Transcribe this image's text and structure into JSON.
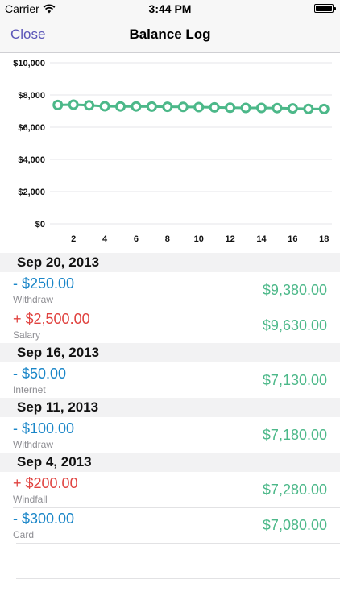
{
  "status_bar": {
    "carrier": "Carrier",
    "time": "3:44 PM"
  },
  "nav": {
    "close_label": "Close",
    "title": "Balance Log"
  },
  "colors": {
    "line": "#4cb889",
    "minus": "#1a86c8",
    "plus": "#e0423f",
    "balance": "#4cb889",
    "nav_tint": "#5a55b8"
  },
  "chart_data": {
    "type": "line",
    "y_ticks": [
      "$10,000",
      "$8,000",
      "$6,000",
      "$4,000",
      "$2,000",
      "$0"
    ],
    "x_ticks": [
      "2",
      "4",
      "6",
      "8",
      "10",
      "12",
      "14",
      "16",
      "18"
    ],
    "ylim": [
      0,
      10000
    ],
    "x": [
      1,
      2,
      3,
      4,
      5,
      6,
      7,
      8,
      9,
      10,
      11,
      12,
      13,
      14,
      15,
      16,
      17,
      18
    ],
    "series": [
      {
        "values": [
          7380,
          7400,
          7360,
          7300,
          7290,
          7290,
          7280,
          7270,
          7260,
          7250,
          7230,
          7210,
          7200,
          7200,
          7190,
          7170,
          7140,
          7130
        ]
      }
    ],
    "grid": true
  },
  "sections": [
    {
      "date": "Sep 20, 2013",
      "rows": [
        {
          "amount": "- $250.00",
          "sign": "minus",
          "category": "Withdraw",
          "balance": "$9,380.00"
        },
        {
          "amount": "+ $2,500.00",
          "sign": "plus",
          "category": "Salary",
          "balance": "$9,630.00"
        }
      ]
    },
    {
      "date": "Sep 16, 2013",
      "rows": [
        {
          "amount": "- $50.00",
          "sign": "minus",
          "category": "Internet",
          "balance": "$7,130.00"
        }
      ]
    },
    {
      "date": "Sep 11, 2013",
      "rows": [
        {
          "amount": "- $100.00",
          "sign": "minus",
          "category": "Withdraw",
          "balance": "$7,180.00"
        }
      ]
    },
    {
      "date": "Sep 4, 2013",
      "rows": [
        {
          "amount": "+ $200.00",
          "sign": "plus",
          "category": "Windfall",
          "balance": "$7,280.00"
        },
        {
          "amount": "- $300.00",
          "sign": "minus",
          "category": "Card",
          "balance": "$7,080.00"
        }
      ]
    }
  ]
}
